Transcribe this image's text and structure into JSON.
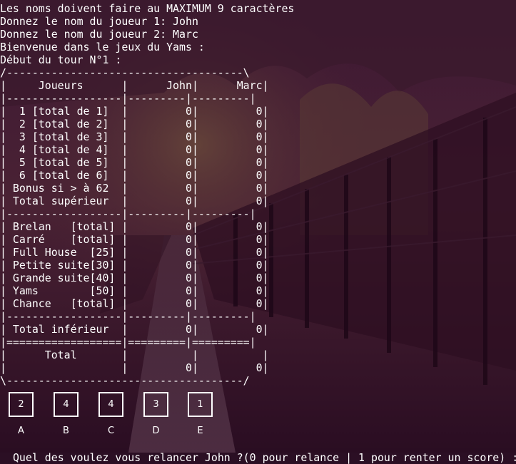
{
  "terminal": {
    "lines": [
      "Les noms doivent faire au MAXIMUM 9 caractères",
      "Donnez le nom du joueur 1: John",
      "Donnez le nom du joueur 2: Marc",
      "Bienvenue dans le jeux du Yams :",
      "Début du tour N°1 :",
      "/-------------------------------------\\",
      "|     Joueurs      |      John|      Marc|",
      "|------------------|---------|---------|",
      "|  1 [total de 1]  |         0|         0|",
      "|  2 [total de 2]  |         0|         0|",
      "|  3 [total de 3]  |         0|         0|",
      "|  4 [total de 4]  |         0|         0|",
      "|  5 [total de 5]  |         0|         0|",
      "|  6 [total de 6]  |         0|         0|",
      "| Bonus si > à 62  |         0|         0|",
      "| Total supérieur  |         0|         0|",
      "|------------------|---------|---------|",
      "| Brelan   [total] |         0|         0|",
      "| Carré    [total] |         0|         0|",
      "| Full House  [25] |         0|         0|",
      "| Petite suite[30] |         0|         0|",
      "| Grande suite[40] |         0|         0|",
      "| Yams        [50] |         0|         0|",
      "| Chance   [total] |         0|         0|",
      "|------------------|---------|---------|",
      "| Total inférieur  |         0|         0|",
      "|==================|=========|=========|",
      "|      Total       |          |          |",
      "|                  |         0|         0|",
      "\\-------------------------------------/"
    ],
    "prompt": "Quel des voulez vous relancer John ?(0 pour relance | 1 pour renter un score) :"
  },
  "dice": [
    {
      "value": "2",
      "letter": "A"
    },
    {
      "value": "4",
      "letter": "B"
    },
    {
      "value": "4",
      "letter": "C"
    },
    {
      "value": "3",
      "letter": "D"
    },
    {
      "value": "1",
      "letter": "E"
    }
  ],
  "colors": {
    "background_tint": "#3a1530",
    "text": "#ffffff"
  }
}
